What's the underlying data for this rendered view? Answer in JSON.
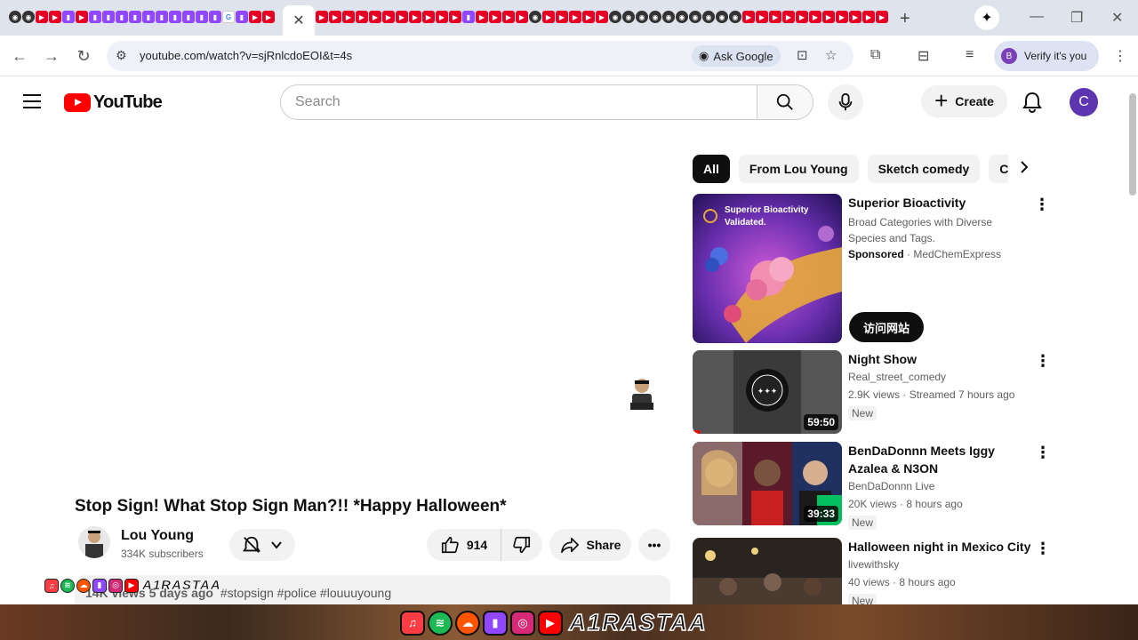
{
  "browser": {
    "active_tab_close": "✕",
    "new_tab": "+",
    "url": "youtube.com/watch?v=sjRnlcdoEOI&t=4s",
    "ask_google": "Ask Google",
    "verify": "Verify it's you",
    "profile_initial": "B"
  },
  "masthead": {
    "logo_text": "YouTube",
    "search_placeholder": "Search",
    "create_label": "Create",
    "avatar_initial": "C"
  },
  "video": {
    "title": "Stop Sign! What Stop Sign Man?!! *Happy Halloween*",
    "channel": "Lou Young",
    "subscribers": "334K subscribers",
    "likes": "914",
    "share_label": "Share",
    "description_meta": "14K views  5 days ago",
    "description_tags": "#stopsign #police #louuuyoung"
  },
  "overlay": {
    "text": "A1RASTAA"
  },
  "sidebar": {
    "chips": [
      "All",
      "From Lou Young",
      "Sketch comedy",
      "Con"
    ],
    "recommendations": [
      {
        "title": "Superior Bioactivity",
        "line1": "Broad Categories with Diverse",
        "line2": "Species and Tags.",
        "sponsored": "Sponsored",
        "advertiser": " · MedChemExpress",
        "thumb_text_1": "Superior Bioactivity",
        "thumb_text_2": "Validated.",
        "cta": "访问网站"
      },
      {
        "title": "Night Show",
        "channel": "Real_street_comedy",
        "meta": "2.9K views · Streamed 7 hours ago",
        "badge": "New",
        "duration": "59:50"
      },
      {
        "title": "BenDaDonnn Meets Iggy Azalea & N3ON",
        "channel": "BenDaDonnn Live",
        "meta": "20K views · 8 hours ago",
        "badge": "New",
        "duration": "39:33"
      },
      {
        "title": "Halloween night in Mexico City",
        "channel": "livewithsky",
        "meta": "40 views · 8 hours ago",
        "badge": "New"
      }
    ]
  }
}
